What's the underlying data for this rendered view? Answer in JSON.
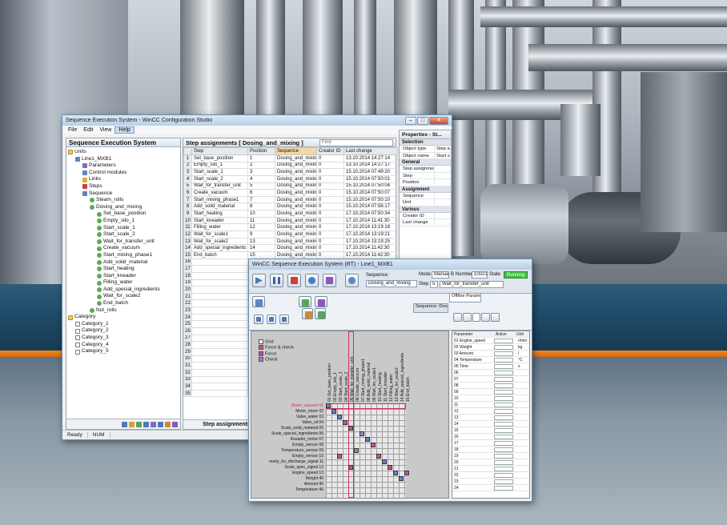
{
  "colors": {
    "accent": "#f08a24",
    "band": "#1f4a66",
    "running": "#3fbe3f",
    "highlight_red": "#d03060"
  },
  "main": {
    "title": "Sequence Execution System - WinCC Configuration Studio",
    "menu": [
      "File",
      "Edit",
      "View",
      "Help"
    ],
    "tree_title": "Sequence Execution System",
    "tree": [
      {
        "label": "Units",
        "icon": "folder-icon",
        "level": 0
      },
      {
        "label": "Line1_MXB1",
        "icon": "unit-icon",
        "level": 1
      },
      {
        "label": "Parameters",
        "icon": "parameters-icon",
        "level": 2
      },
      {
        "label": "Control modules",
        "icon": "control-modules-icon",
        "level": 2
      },
      {
        "label": "Links",
        "icon": "links-icon",
        "level": 2
      },
      {
        "label": "Steps",
        "icon": "steps-icon",
        "level": 2
      },
      {
        "label": "Sequence",
        "icon": "sequence-icon",
        "level": 2
      },
      {
        "label": "Steam_rolls",
        "icon": "step-icon",
        "level": 3
      },
      {
        "label": "Dosing_and_mixing",
        "icon": "step-icon",
        "level": 3
      },
      {
        "label": "Set_base_position",
        "icon": "step-icon",
        "level": 4
      },
      {
        "label": "Empty_silo_1",
        "icon": "step-icon",
        "level": 4
      },
      {
        "label": "Start_scale_1",
        "icon": "step-icon",
        "level": 4
      },
      {
        "label": "Start_scale_2",
        "icon": "step-icon",
        "level": 4
      },
      {
        "label": "Wait_for_transfer_unit",
        "icon": "step-icon",
        "level": 4
      },
      {
        "label": "Create_vacuum",
        "icon": "step-icon",
        "level": 4
      },
      {
        "label": "Start_mixing_phase1",
        "icon": "step-icon",
        "level": 4
      },
      {
        "label": "Add_solid_material",
        "icon": "step-icon",
        "level": 4
      },
      {
        "label": "Start_heating",
        "icon": "step-icon",
        "level": 4
      },
      {
        "label": "Start_kneader",
        "icon": "step-icon",
        "level": 4
      },
      {
        "label": "Filling_water",
        "icon": "step-icon",
        "level": 4
      },
      {
        "label": "Add_special_ingredients",
        "icon": "step-icon",
        "level": 4
      },
      {
        "label": "Wait_for_scale2",
        "icon": "step-icon",
        "level": 4
      },
      {
        "label": "End_batch",
        "icon": "step-icon",
        "level": 4
      },
      {
        "label": "Nut_rolls",
        "icon": "step-icon",
        "level": 3
      },
      {
        "label": "Category",
        "icon": "folder-icon",
        "level": 0
      },
      {
        "label": "Category_1",
        "icon": "category-icon",
        "level": 1
      },
      {
        "label": "Category_2",
        "icon": "category-icon",
        "level": 1
      },
      {
        "label": "Category_3",
        "icon": "category-icon",
        "level": 1
      },
      {
        "label": "Category_4",
        "icon": "category-icon",
        "level": 1
      },
      {
        "label": "Category_5",
        "icon": "category-icon",
        "level": 1
      }
    ],
    "grid_title": "Step assignments [ Dosing_and_mixing ]",
    "find_placeholder": "Find",
    "columns": [
      "Step",
      "Position",
      "Sequence",
      "Creator ID",
      "Last change"
    ],
    "rows": [
      [
        "Set_base_position",
        "1",
        "Dosing_and_mixing",
        "0",
        "13.10.2014 14:27:14"
      ],
      [
        "Empty_silo_1",
        "2",
        "Dosing_and_mixing",
        "0",
        "13.10.2014 14:27:17"
      ],
      [
        "Start_scale_1",
        "3",
        "Dosing_and_mixing",
        "0",
        "15.10.2014 07:49:20"
      ],
      [
        "Start_scale_2",
        "4",
        "Dosing_and_mixing",
        "0",
        "15.10.2014 07:50:01"
      ],
      [
        "Wait_for_transfer_unit",
        "5",
        "Dosing_and_mixing",
        "0",
        "15.10.2014 07:50:04"
      ],
      [
        "Create_vacuum",
        "6",
        "Dosing_and_mixing",
        "0",
        "15.10.2014 07:50:07"
      ],
      [
        "Start_mixing_phase1",
        "7",
        "Dosing_and_mixing",
        "0",
        "15.10.2014 07:50:10"
      ],
      [
        "Add_solid_material",
        "8",
        "Dosing_and_mixing",
        "0",
        "15.10.2014 07:56:17"
      ],
      [
        "Start_heating",
        "10",
        "Dosing_and_mixing",
        "0",
        "17.10.2014 07:50:34"
      ],
      [
        "Start_kneader",
        "11",
        "Dosing_and_mixing",
        "0",
        "17.10.2014 11:41:30"
      ],
      [
        "Filling_water",
        "12",
        "Dosing_and_mixing",
        "0",
        "17.10.2014 13:19:18"
      ],
      [
        "Wait_for_scale1",
        "9",
        "Dosing_and_mixing",
        "0",
        "17.10.2014 13:19:21"
      ],
      [
        "Wait_for_scale2",
        "13",
        "Dosing_and_mixing",
        "0",
        "17.10.2014 13:19:25"
      ],
      [
        "Add_special_ingredients",
        "14",
        "Dosing_and_mixing",
        "0",
        "17.10.2014 11:42:30"
      ],
      [
        "End_batch",
        "15",
        "Dosing_and_mixing",
        "0",
        "17.10.2014 11:42:30"
      ]
    ],
    "row_count": 35,
    "grid_footer": "Step assignments",
    "props_title": "Properties - St...",
    "props": [
      {
        "section": "Selection",
        "items": [
          [
            "Object type",
            "Step a"
          ],
          [
            "Object name",
            "Start s"
          ]
        ]
      },
      {
        "section": "General",
        "items": [
          [
            "Step assignment ID",
            ""
          ],
          [
            "Step",
            ""
          ],
          [
            "Position",
            ""
          ]
        ]
      },
      {
        "section": "Assignment",
        "items": [
          [
            "Sequence",
            ""
          ],
          [
            "Unit",
            ""
          ]
        ]
      },
      {
        "section": "Various",
        "items": [
          [
            "Creator ID",
            ""
          ],
          [
            "Last change",
            ""
          ]
        ]
      }
    ],
    "status": [
      "Ready",
      "NUM"
    ]
  },
  "runtime": {
    "title": "WinCC Sequence Execution System (RT) - Line1_MXB1",
    "sequence_label": "Sequence:",
    "sequence_value": "Dosing_and_mixing",
    "mode_label": "Mode",
    "mode_value": "Manual",
    "bnumber_label": "B Number",
    "bnumber_value": "100215",
    "state_label": "State",
    "state_value": "Running",
    "step_label": "Step",
    "step_num": "5",
    "step_value": "Wait_for_transfer_unit",
    "tab_sequence": "Sequence: Dosing_and_mixing",
    "tab_offline": "Offline Parameter",
    "grid_label": "Grid",
    "legend": [
      "Force & check",
      "Force",
      "Check"
    ],
    "columns": [
      "01 Set_base_position",
      "02 Empty_silo_1",
      "03 Start_scale_1",
      "04 Start_scale_2",
      "05 Wait_for_transfer_unit",
      "06 Create_vacuum",
      "07 Start_mixing_phase1",
      "08 Add_solid_material",
      "09 Wait_for_scale1",
      "10 Start_heating",
      "11 Start_kneader",
      "12 Filling_water",
      "13 Wait_for_scale2",
      "14 Add_special_ingredients",
      "15 End_batch"
    ],
    "row_labels": [
      "Motor_vacuum 01",
      "Motor_mixer 02",
      "Valve_water 03",
      "Valve_oil 04",
      "Scale_solid_material 05",
      "Scale_special_ingredients 06",
      "Kneader_motor 07",
      "Empty_sensor 08",
      "Temperature_sensor 09",
      "Empty_sensor 10",
      "ready_for_discharge_signal 11",
      "Scale_spec_signal 12",
      "Engine_speed 13",
      "Weight 40",
      "Amount 45",
      "Temperature 46"
    ],
    "param_headers": [
      "Parameter",
      "Active",
      "Unit"
    ],
    "params": [
      "01 Engine_speed",
      "02 Weight",
      "03 Amount",
      "04 Temperature",
      "05 Time",
      "06",
      "07",
      "08",
      "09",
      "10",
      "11",
      "12",
      "13",
      "14",
      "15",
      "16",
      "17",
      "18",
      "19",
      "20",
      "21",
      "22",
      "23",
      "24"
    ],
    "units": [
      "r/min",
      "kg",
      "l",
      "°C",
      "s"
    ]
  }
}
